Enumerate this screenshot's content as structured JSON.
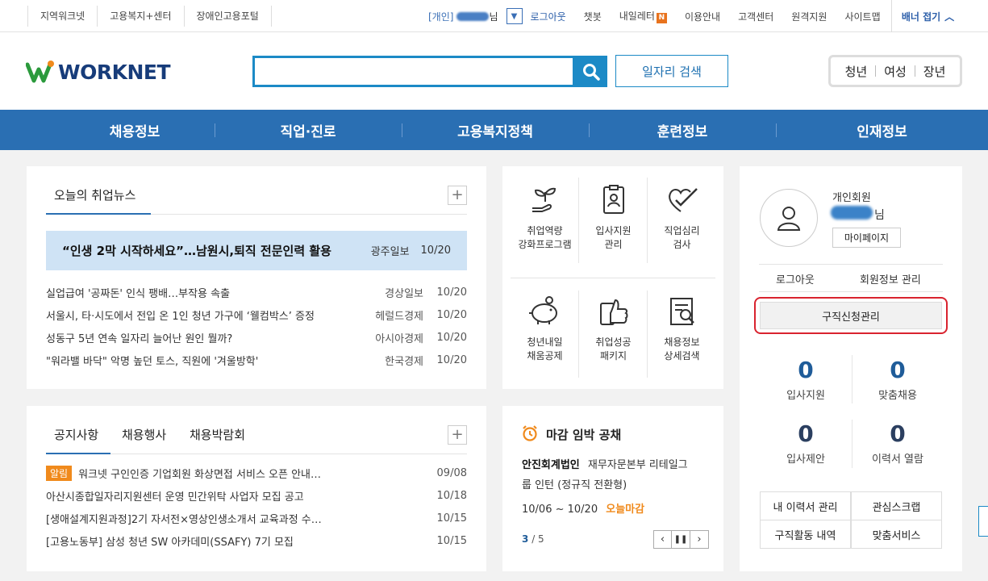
{
  "topbar": {
    "left_links": [
      "지역워크넷",
      "고용복지+센터",
      "장애인고용포털"
    ],
    "member_tag": "[개인]",
    "member_suffix": "님",
    "links": [
      "로그아웃",
      "챗봇",
      "내일레터",
      "이용안내",
      "고객센터",
      "원격지원",
      "사이트맵"
    ],
    "new_badge": "N",
    "banner_fold": "배너 접기"
  },
  "header": {
    "logo": "WORKNET",
    "search_value": "",
    "job_search_label": "일자리 검색",
    "segments": [
      "청년",
      "여성",
      "장년"
    ]
  },
  "nav": [
    "채용정보",
    "직업·진로",
    "고용복지정책",
    "훈련정보",
    "인재정보"
  ],
  "news": {
    "title": "오늘의 취업뉴스",
    "headline": {
      "title": "“인생 2막 시작하세요”…남원시,퇴직 전문인력 활용",
      "source": "광주일보",
      "date": "10/20"
    },
    "items": [
      {
        "title": "실업급여 '공짜돈' 인식 팽배…부작용 속출",
        "source": "경상일보",
        "date": "10/20"
      },
      {
        "title": "서울시, 타·시도에서 전입 온 1인 청년 가구에 ‘웰컴박스’ 증정",
        "source": "헤럴드경제",
        "date": "10/20"
      },
      {
        "title": "성동구 5년 연속 일자리 늘어난 원인 뭘까?",
        "source": "아시아경제",
        "date": "10/20"
      },
      {
        "title": "\"워라밸 바닥\" 악명 높던 토스, 직원에 '겨울방학'",
        "source": "한국경제",
        "date": "10/20"
      }
    ]
  },
  "notice": {
    "tabs": [
      "공지사항",
      "채용행사",
      "채용박람회"
    ],
    "alert_badge": "알림",
    "items": [
      {
        "title": "워크넷 구인인증 기업회원 화상면접 서비스 오픈 안내…",
        "date": "09/08"
      },
      {
        "title": "아산시종합일자리지원센터 운영 민간위탁 사업자 모집 공고",
        "date": "10/18"
      },
      {
        "title": "[생애설계지원과정]2기 자서전×영상인생소개서 교육과정 수…",
        "date": "10/15"
      },
      {
        "title": "[고용노동부] 삼성 청년 SW 아카데미(SSAFY) 7기 모집",
        "date": "10/15"
      }
    ]
  },
  "quick_menu": [
    {
      "label": "취업역량\n강화프로그램",
      "icon": "plant-hand-icon"
    },
    {
      "label": "입사지원\n관리",
      "icon": "id-card-icon"
    },
    {
      "label": "직업심리\n검사",
      "icon": "heart-check-icon"
    },
    {
      "label": "청년내일\n채움공제",
      "icon": "piggy-bank-icon"
    },
    {
      "label": "취업성공\n패키지",
      "icon": "thumbs-up-icon"
    },
    {
      "label": "채용정보\n상세검색",
      "icon": "document-search-icon"
    }
  ],
  "deadline": {
    "title": "마감 임박 공채",
    "company": "안진회계법인",
    "desc_line1": "재무자문본부 리테일그",
    "desc_line2": "룹 인턴 (정규직 전환형)",
    "period": "10/06 ~ 10/20",
    "status": "오늘마감",
    "page_current": "3",
    "page_total": "/ 5"
  },
  "member": {
    "type": "개인회원",
    "suffix": "님",
    "mypage": "마이페이지",
    "logout": "로그아웃",
    "info": "회원정보 관리",
    "apply_manage": "구직신청관리",
    "stats": [
      {
        "value": "0",
        "label": "입사지원"
      },
      {
        "value": "0",
        "label": "맞춤채용"
      },
      {
        "value": "0",
        "label": "입사제안"
      },
      {
        "value": "0",
        "label": "이력서 열람"
      }
    ],
    "grid": [
      "내 이력서 관리",
      "관심스크랩",
      "구직활동 내역",
      "맞춤서비스"
    ]
  }
}
